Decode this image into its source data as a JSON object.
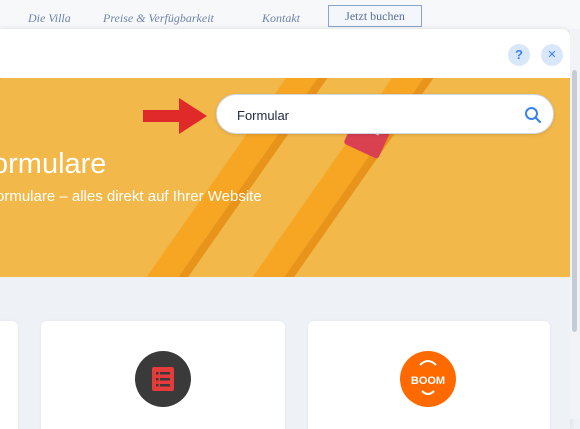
{
  "site_nav": {
    "links": [
      "Die Villa",
      "Preise & Verfügbarkeit",
      "Kontakt"
    ],
    "book_label": "Jetzt buchen"
  },
  "modal": {
    "help_label": "?",
    "close_label": "✕"
  },
  "hero": {
    "title": "ormulare",
    "subtitle": "ormulare – alles direkt auf Ihrer Website",
    "background_color": "#f2b84a"
  },
  "search": {
    "value": "Formular",
    "icon": "search-icon"
  },
  "colors": {
    "accent": "#3b82f0",
    "arrow": "#e02a2a",
    "forms_icon": "#3a3a3a",
    "boom_icon": "#ff6a00"
  },
  "cards": [
    {
      "icon": "list-icon"
    },
    {
      "icon": "boom-logo-icon",
      "logo_text": "BOOM"
    }
  ]
}
